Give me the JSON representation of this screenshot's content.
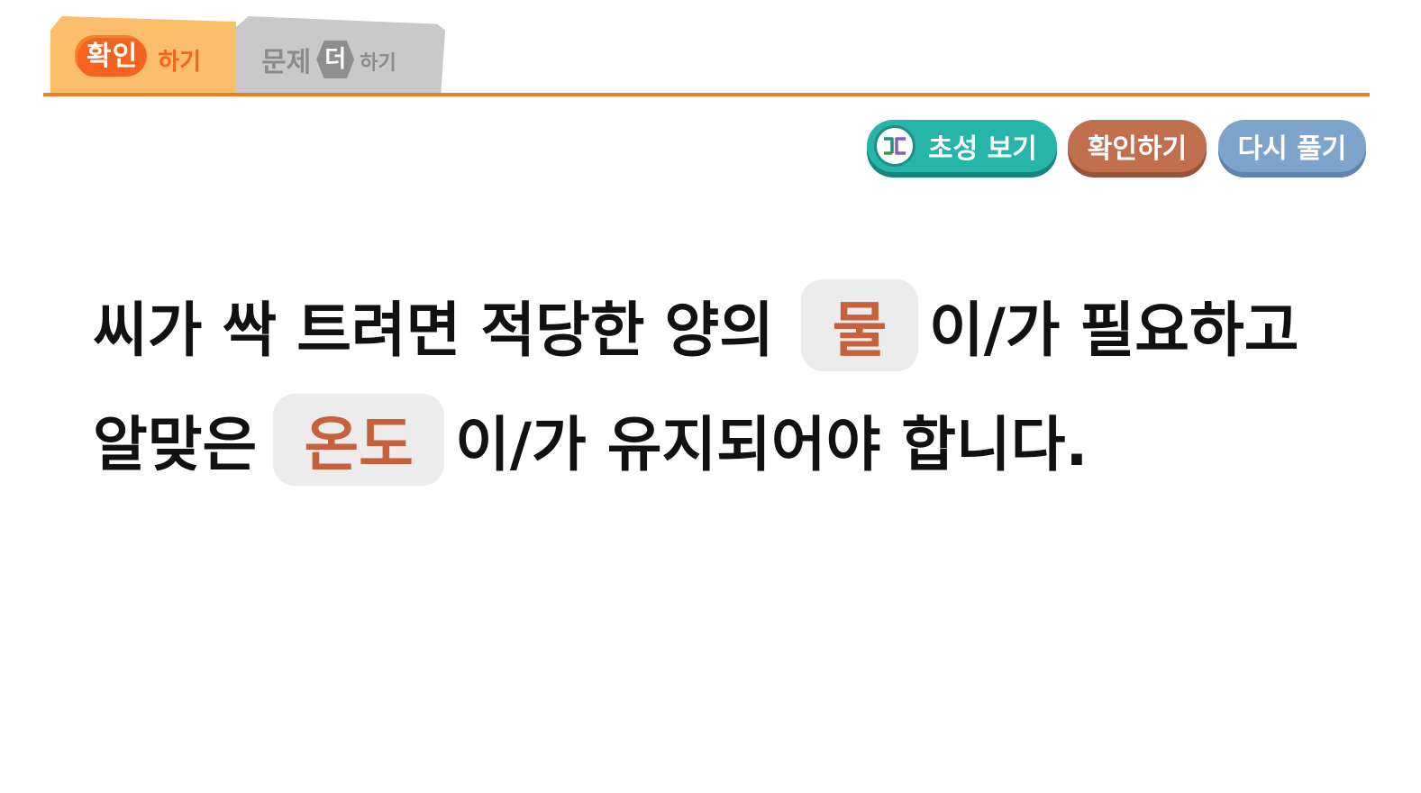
{
  "tabs": {
    "check": {
      "badge": "확인",
      "suffix": "하기"
    },
    "more": {
      "prefix": "문제",
      "badge": "더",
      "suffix": "하기"
    }
  },
  "actions": {
    "hint": {
      "icon_text": "ㄱㄷ",
      "label": "초성 보기"
    },
    "check": {
      "label": "확인하기"
    },
    "retry": {
      "label": "다시 풀기"
    }
  },
  "sentence": {
    "line1": {
      "words": [
        "씨가",
        "싹",
        "트려면",
        "적당한",
        "양의"
      ],
      "answer": "물",
      "after": [
        "이/가",
        "필요하고"
      ]
    },
    "line2": {
      "before": "알맞은",
      "answer": "온도",
      "after": "이/가 유지되어야 합니다."
    }
  },
  "colors": {
    "accent_orange": "#f07d1f",
    "answer_text": "#c7603b",
    "hint_button": "#26b5a8",
    "check_button": "#c0704f",
    "retry_button": "#7ea4cc"
  }
}
